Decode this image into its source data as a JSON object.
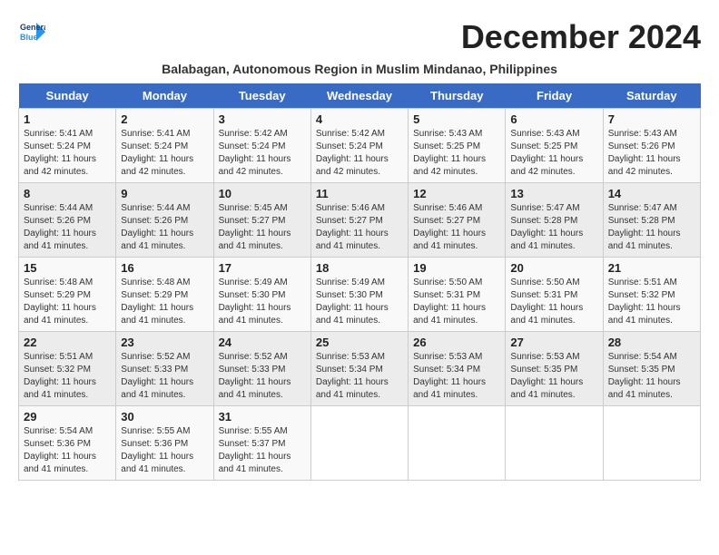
{
  "logo": {
    "line1": "General",
    "line2": "Blue"
  },
  "title": "December 2024",
  "subtitle": "Balabagan, Autonomous Region in Muslim Mindanao, Philippines",
  "days_of_week": [
    "Sunday",
    "Monday",
    "Tuesday",
    "Wednesday",
    "Thursday",
    "Friday",
    "Saturday"
  ],
  "weeks": [
    [
      {
        "day": "1",
        "sunrise": "Sunrise: 5:41 AM",
        "sunset": "Sunset: 5:24 PM",
        "daylight": "Daylight: 11 hours and 42 minutes."
      },
      {
        "day": "2",
        "sunrise": "Sunrise: 5:41 AM",
        "sunset": "Sunset: 5:24 PM",
        "daylight": "Daylight: 11 hours and 42 minutes."
      },
      {
        "day": "3",
        "sunrise": "Sunrise: 5:42 AM",
        "sunset": "Sunset: 5:24 PM",
        "daylight": "Daylight: 11 hours and 42 minutes."
      },
      {
        "day": "4",
        "sunrise": "Sunrise: 5:42 AM",
        "sunset": "Sunset: 5:24 PM",
        "daylight": "Daylight: 11 hours and 42 minutes."
      },
      {
        "day": "5",
        "sunrise": "Sunrise: 5:43 AM",
        "sunset": "Sunset: 5:25 PM",
        "daylight": "Daylight: 11 hours and 42 minutes."
      },
      {
        "day": "6",
        "sunrise": "Sunrise: 5:43 AM",
        "sunset": "Sunset: 5:25 PM",
        "daylight": "Daylight: 11 hours and 42 minutes."
      },
      {
        "day": "7",
        "sunrise": "Sunrise: 5:43 AM",
        "sunset": "Sunset: 5:26 PM",
        "daylight": "Daylight: 11 hours and 42 minutes."
      }
    ],
    [
      {
        "day": "8",
        "sunrise": "Sunrise: 5:44 AM",
        "sunset": "Sunset: 5:26 PM",
        "daylight": "Daylight: 11 hours and 41 minutes."
      },
      {
        "day": "9",
        "sunrise": "Sunrise: 5:44 AM",
        "sunset": "Sunset: 5:26 PM",
        "daylight": "Daylight: 11 hours and 41 minutes."
      },
      {
        "day": "10",
        "sunrise": "Sunrise: 5:45 AM",
        "sunset": "Sunset: 5:27 PM",
        "daylight": "Daylight: 11 hours and 41 minutes."
      },
      {
        "day": "11",
        "sunrise": "Sunrise: 5:46 AM",
        "sunset": "Sunset: 5:27 PM",
        "daylight": "Daylight: 11 hours and 41 minutes."
      },
      {
        "day": "12",
        "sunrise": "Sunrise: 5:46 AM",
        "sunset": "Sunset: 5:27 PM",
        "daylight": "Daylight: 11 hours and 41 minutes."
      },
      {
        "day": "13",
        "sunrise": "Sunrise: 5:47 AM",
        "sunset": "Sunset: 5:28 PM",
        "daylight": "Daylight: 11 hours and 41 minutes."
      },
      {
        "day": "14",
        "sunrise": "Sunrise: 5:47 AM",
        "sunset": "Sunset: 5:28 PM",
        "daylight": "Daylight: 11 hours and 41 minutes."
      }
    ],
    [
      {
        "day": "15",
        "sunrise": "Sunrise: 5:48 AM",
        "sunset": "Sunset: 5:29 PM",
        "daylight": "Daylight: 11 hours and 41 minutes."
      },
      {
        "day": "16",
        "sunrise": "Sunrise: 5:48 AM",
        "sunset": "Sunset: 5:29 PM",
        "daylight": "Daylight: 11 hours and 41 minutes."
      },
      {
        "day": "17",
        "sunrise": "Sunrise: 5:49 AM",
        "sunset": "Sunset: 5:30 PM",
        "daylight": "Daylight: 11 hours and 41 minutes."
      },
      {
        "day": "18",
        "sunrise": "Sunrise: 5:49 AM",
        "sunset": "Sunset: 5:30 PM",
        "daylight": "Daylight: 11 hours and 41 minutes."
      },
      {
        "day": "19",
        "sunrise": "Sunrise: 5:50 AM",
        "sunset": "Sunset: 5:31 PM",
        "daylight": "Daylight: 11 hours and 41 minutes."
      },
      {
        "day": "20",
        "sunrise": "Sunrise: 5:50 AM",
        "sunset": "Sunset: 5:31 PM",
        "daylight": "Daylight: 11 hours and 41 minutes."
      },
      {
        "day": "21",
        "sunrise": "Sunrise: 5:51 AM",
        "sunset": "Sunset: 5:32 PM",
        "daylight": "Daylight: 11 hours and 41 minutes."
      }
    ],
    [
      {
        "day": "22",
        "sunrise": "Sunrise: 5:51 AM",
        "sunset": "Sunset: 5:32 PM",
        "daylight": "Daylight: 11 hours and 41 minutes."
      },
      {
        "day": "23",
        "sunrise": "Sunrise: 5:52 AM",
        "sunset": "Sunset: 5:33 PM",
        "daylight": "Daylight: 11 hours and 41 minutes."
      },
      {
        "day": "24",
        "sunrise": "Sunrise: 5:52 AM",
        "sunset": "Sunset: 5:33 PM",
        "daylight": "Daylight: 11 hours and 41 minutes."
      },
      {
        "day": "25",
        "sunrise": "Sunrise: 5:53 AM",
        "sunset": "Sunset: 5:34 PM",
        "daylight": "Daylight: 11 hours and 41 minutes."
      },
      {
        "day": "26",
        "sunrise": "Sunrise: 5:53 AM",
        "sunset": "Sunset: 5:34 PM",
        "daylight": "Daylight: 11 hours and 41 minutes."
      },
      {
        "day": "27",
        "sunrise": "Sunrise: 5:53 AM",
        "sunset": "Sunset: 5:35 PM",
        "daylight": "Daylight: 11 hours and 41 minutes."
      },
      {
        "day": "28",
        "sunrise": "Sunrise: 5:54 AM",
        "sunset": "Sunset: 5:35 PM",
        "daylight": "Daylight: 11 hours and 41 minutes."
      }
    ],
    [
      {
        "day": "29",
        "sunrise": "Sunrise: 5:54 AM",
        "sunset": "Sunset: 5:36 PM",
        "daylight": "Daylight: 11 hours and 41 minutes."
      },
      {
        "day": "30",
        "sunrise": "Sunrise: 5:55 AM",
        "sunset": "Sunset: 5:36 PM",
        "daylight": "Daylight: 11 hours and 41 minutes."
      },
      {
        "day": "31",
        "sunrise": "Sunrise: 5:55 AM",
        "sunset": "Sunset: 5:37 PM",
        "daylight": "Daylight: 11 hours and 41 minutes."
      },
      null,
      null,
      null,
      null
    ]
  ]
}
